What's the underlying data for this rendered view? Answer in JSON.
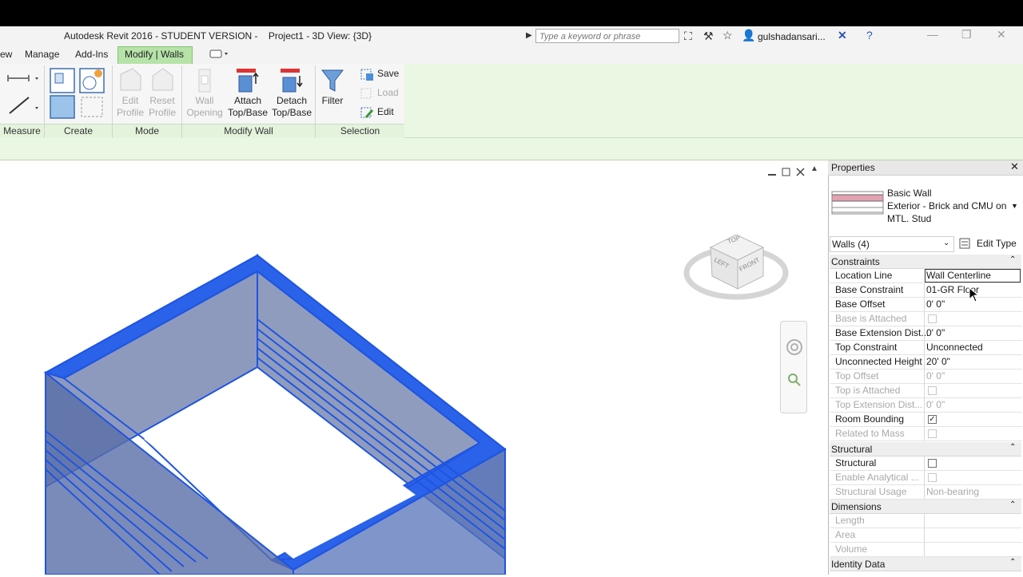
{
  "window": {
    "title": "Autodesk Revit 2016 - STUDENT VERSION -",
    "view_title": "Project1 - 3D View: {3D}",
    "search_placeholder": "Type a keyword or phrase",
    "user": "gulshadansari..."
  },
  "ribbon": {
    "tabs": [
      "ew",
      "Manage",
      "Add-Ins",
      "Modify | Walls"
    ],
    "panels": {
      "measure": "Measure",
      "create": "Create",
      "mode": "Mode",
      "modify_wall": "Modify Wall",
      "selection": "Selection"
    },
    "buttons": {
      "edit_profile": [
        "Edit",
        "Profile"
      ],
      "reset_profile": [
        "Reset",
        "Profile"
      ],
      "wall_opening": [
        "Wall",
        "Opening"
      ],
      "attach": [
        "Attach",
        "Top/Base"
      ],
      "detach": [
        "Detach",
        "Top/Base"
      ],
      "filter": "Filter",
      "save": "Save",
      "load": "Load",
      "edit": "Edit"
    }
  },
  "viewcube": {
    "top": "TOP",
    "front": "FRONT",
    "left": "LEFT"
  },
  "properties": {
    "title": "Properties",
    "family": "Basic Wall",
    "type_line1": "Exterior - Brick and CMU on",
    "type_line2": "MTL. Stud",
    "selector": "Walls (4)",
    "edit_type": "Edit Type",
    "sections": {
      "constraints": "Constraints",
      "structural": "Structural",
      "dimensions": "Dimensions",
      "identity": "Identity Data"
    },
    "rows": [
      {
        "label": "Location Line",
        "value": "Wall Centerline"
      },
      {
        "label": "Base Constraint",
        "value": "01-GR Floor"
      },
      {
        "label": "Base Offset",
        "value": "0'  0\""
      },
      {
        "label": "Base is Attached",
        "value": ""
      },
      {
        "label": "Base Extension Dist...",
        "value": "0'  0\""
      },
      {
        "label": "Top Constraint",
        "value": "Unconnected"
      },
      {
        "label": "Unconnected Height",
        "value": "20'  0\""
      },
      {
        "label": "Top Offset",
        "value": "0'  0\""
      },
      {
        "label": "Top is Attached",
        "value": ""
      },
      {
        "label": "Top Extension Dist...",
        "value": "0'  0\""
      },
      {
        "label": "Room Bounding",
        "value": ""
      },
      {
        "label": "Related to Mass",
        "value": ""
      },
      {
        "label": "Structural",
        "value": ""
      },
      {
        "label": "Enable Analytical ...",
        "value": ""
      },
      {
        "label": "Structural Usage",
        "value": "Non-bearing"
      },
      {
        "label": "Length",
        "value": ""
      },
      {
        "label": "Area",
        "value": ""
      },
      {
        "label": "Volume",
        "value": ""
      }
    ]
  },
  "colors": {
    "ribbon_green": "#eaf7e3",
    "active_tab": "#b6e3a8",
    "wall_blue": "#1f55e0",
    "wall_fill": "#3f5fa6"
  }
}
